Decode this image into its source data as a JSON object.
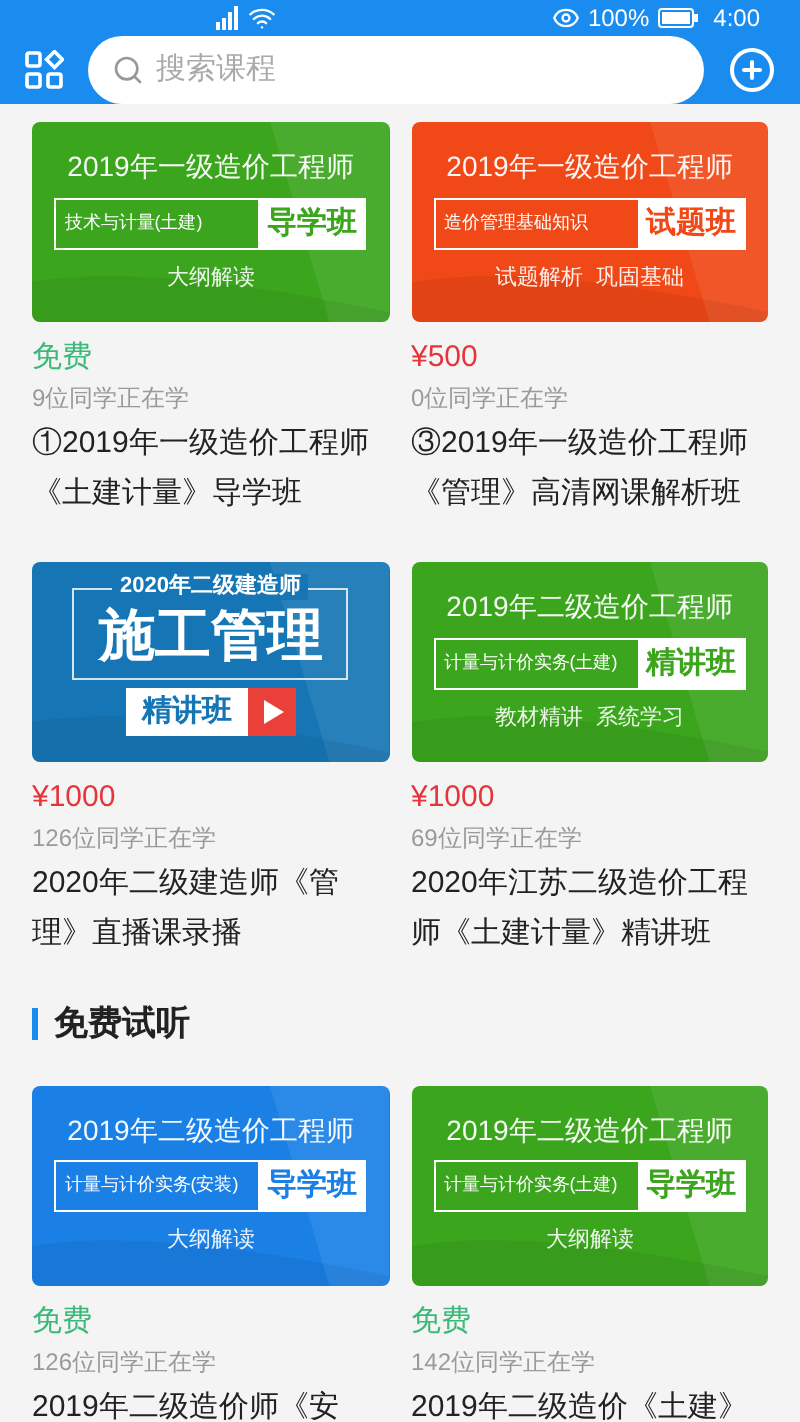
{
  "status_bar": {
    "battery": "100%",
    "time": "4:00"
  },
  "header": {
    "search": {
      "placeholder": "搜索课程"
    }
  },
  "courses": [
    {
      "banner": {
        "kind": "standard",
        "color": "#3ba51d",
        "title": "2019年一级造价工程师",
        "label": "技术与计量(土建)",
        "badge": "导学班",
        "tagline": "大纲解读"
      },
      "price": {
        "kind": "free",
        "text": "免费"
      },
      "students": "9位同学正在学",
      "title": "①2019年一级造价工程师《土建计量》导学班"
    },
    {
      "banner": {
        "kind": "standard",
        "color": "#f04816",
        "title": "2019年一级造价工程师",
        "label": "造价管理基础知识",
        "badge": "试题班",
        "tagline": "试题解析  巩固基础"
      },
      "price": {
        "kind": "paid",
        "text": "¥500"
      },
      "students": "0位同学正在学",
      "title": "③2019年一级造价工程师《管理》高清网课解析班"
    },
    {
      "banner": {
        "kind": "feature",
        "color": "#1676b5",
        "title": "2020年二级建造师",
        "headline": "施工管理",
        "badge": "精讲班"
      },
      "price": {
        "kind": "paid",
        "text": "¥1000"
      },
      "students": "126位同学正在学",
      "title": "2020年二级建造师《管理》直播课录播"
    },
    {
      "banner": {
        "kind": "standard",
        "color": "#3ba51d",
        "title": "2019年二级造价工程师",
        "label": "计量与计价实务(土建)",
        "badge": "精讲班",
        "tagline": "教材精讲  系统学习"
      },
      "price": {
        "kind": "paid",
        "text": "¥1000"
      },
      "students": "69位同学正在学",
      "title": "2020年江苏二级造价工程师《土建计量》精讲班"
    }
  ],
  "free_section": {
    "heading": "免费试听",
    "courses": [
      {
        "banner": {
          "kind": "standard",
          "color": "#1a80e6",
          "title": "2019年二级造价工程师",
          "label": "计量与计价实务(安装)",
          "badge": "导学班",
          "tagline": "大纲解读"
        },
        "price": {
          "kind": "free",
          "text": "免费"
        },
        "students": "126位同学正在学",
        "title": "2019年二级造价师《安"
      },
      {
        "banner": {
          "kind": "standard",
          "color": "#3ba51d",
          "title": "2019年二级造价工程师",
          "label": "计量与计价实务(土建)",
          "badge": "导学班",
          "tagline": "大纲解读"
        },
        "price": {
          "kind": "free",
          "text": "免费"
        },
        "students": "142位同学正在学",
        "title": "2019年二级造价《土建》"
      }
    ]
  }
}
